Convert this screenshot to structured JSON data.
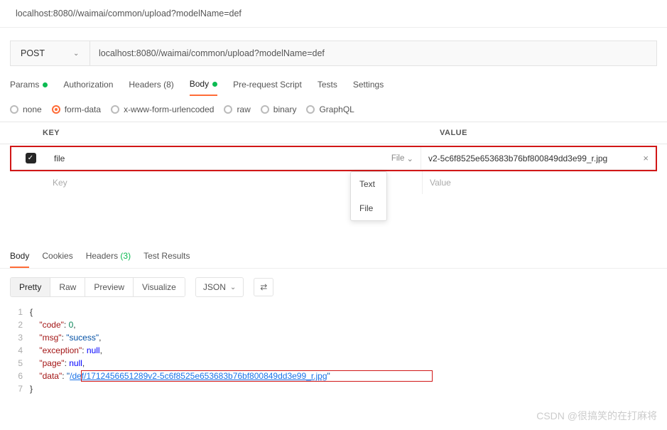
{
  "url_display": "localhost:8080//waimai/common/upload?modelName=def",
  "request": {
    "method": "POST",
    "url": "localhost:8080//waimai/common/upload?modelName=def"
  },
  "tabs": {
    "params": "Params",
    "auth": "Authorization",
    "headers": "Headers (8)",
    "body": "Body",
    "prereq": "Pre-request Script",
    "tests": "Tests",
    "settings": "Settings"
  },
  "body_types": {
    "none": "none",
    "formdata": "form-data",
    "xwww": "x-www-form-urlencoded",
    "raw": "raw",
    "binary": "binary",
    "graphql": "GraphQL"
  },
  "table": {
    "key_header": "KEY",
    "value_header": "VALUE",
    "key_placeholder": "Key",
    "value_placeholder": "Value",
    "row": {
      "key": "file",
      "type_label": "File",
      "value": "v2-5c6f8525e653683b76bf800849dd3e99_r.jpg"
    },
    "dropdown": {
      "text": "Text",
      "file": "File"
    }
  },
  "response_tabs": {
    "body": "Body",
    "cookies": "Cookies",
    "headers": "Headers ",
    "headers_count": "(3)",
    "tests": "Test Results"
  },
  "view_modes": {
    "pretty": "Pretty",
    "raw": "Raw",
    "preview": "Preview",
    "visualize": "Visualize",
    "format": "JSON"
  },
  "json_lines": [
    {
      "n": "1",
      "c": "{"
    },
    {
      "n": "2",
      "c": "    \"code\": 0,"
    },
    {
      "n": "3",
      "c": "    \"msg\": \"sucess\","
    },
    {
      "n": "4",
      "c": "    \"exception\": null,"
    },
    {
      "n": "5",
      "c": "    \"page\": null,"
    },
    {
      "n": "6",
      "c": "    \"data\": \"/def/1712456651289v2-5c6f8525e653683b76bf800849dd3e99_r.jpg\""
    },
    {
      "n": "7",
      "c": "}"
    }
  ],
  "watermark": "CSDN @很搞笑的在打麻将"
}
